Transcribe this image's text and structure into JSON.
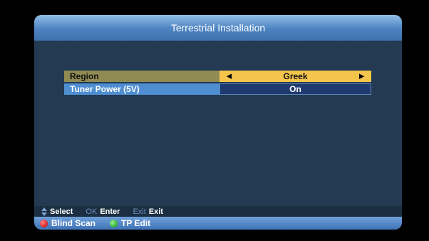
{
  "header": {
    "title": "Terrestrial Installation"
  },
  "settings": [
    {
      "label": "Region",
      "value": "Greek"
    },
    {
      "label": "Tuner Power (5V)",
      "value": "On"
    }
  ],
  "help": {
    "select_label": "Select",
    "ok_key": "OK",
    "enter_label": "Enter",
    "exit_key": "Exit",
    "exit_label": "Exit"
  },
  "footer": {
    "red_label": "Blind Scan",
    "green_label": "TP Edit"
  },
  "colors": {
    "red": "#e53030",
    "green": "#3fbf3f",
    "accent": "#4c82c0",
    "highlight": "#f4c44c"
  },
  "icons": {
    "select": "up-down-arrows-icon",
    "left": "left-triangle-icon",
    "right": "right-triangle-icon",
    "red": "red-button-icon",
    "green": "green-button-icon"
  }
}
